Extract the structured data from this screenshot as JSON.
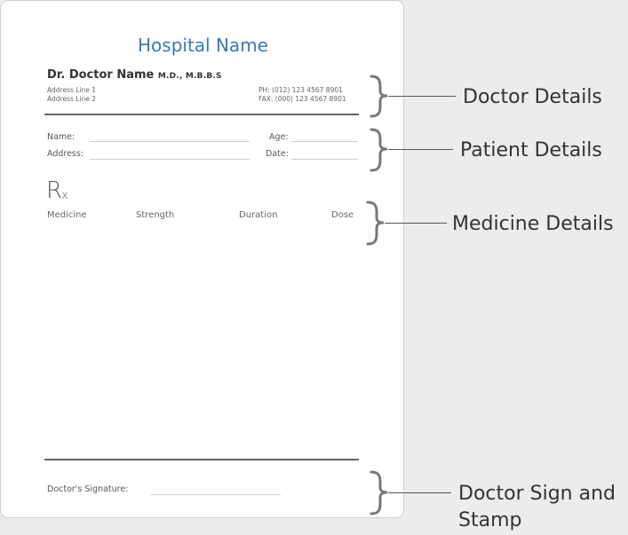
{
  "prescription": {
    "hospital_name": "Hospital Name",
    "doctor_name": "Dr. Doctor Name",
    "doctor_quals": "M.D., M.B.B.S",
    "address_line_1": "Address Line 1",
    "address_line_2": "Address Line 2",
    "phone": "PH: (012) 123 4567 8901",
    "fax": "FAX: (000) 123 4567 8901",
    "patient_name_label": "Name:",
    "patient_address_label": "Address:",
    "age_label": "Age:",
    "date_label": "Date:",
    "rx_main": "R",
    "rx_sub": "x",
    "columns": [
      "Medicine",
      "Strength",
      "Duration",
      "Dose"
    ],
    "signature_label": "Doctor's Signature:"
  },
  "callouts": {
    "doctor_details": "Doctor Details",
    "patient_details": "Patient Details",
    "medicine_details": "Medicine Details",
    "doctor_sign_line1": "Doctor Sign and",
    "doctor_sign_line2": "Stamp"
  },
  "colors": {
    "hospital_blue": "#3b78b6",
    "background": "#ececec"
  }
}
